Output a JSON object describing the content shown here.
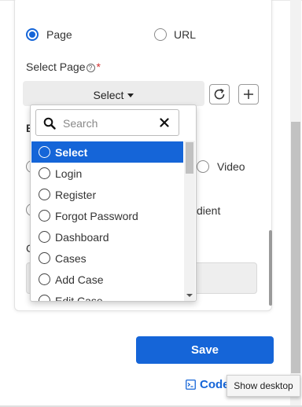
{
  "source": {
    "page_label": "Page",
    "url_label": "URL",
    "selected": "Page"
  },
  "select_page": {
    "label": "Select Page",
    "help": "?",
    "required": "*",
    "button_label": "Select"
  },
  "partials": {
    "b": "B",
    "video": "Video",
    "gradient": "dient",
    "c": "C"
  },
  "dropdown": {
    "search_placeholder": "Search",
    "options": [
      {
        "label": "Select",
        "selected": true
      },
      {
        "label": "Login",
        "selected": false
      },
      {
        "label": "Register",
        "selected": false
      },
      {
        "label": "Forgot Password",
        "selected": false
      },
      {
        "label": "Dashboard",
        "selected": false
      },
      {
        "label": "Cases",
        "selected": false
      },
      {
        "label": "Add Case",
        "selected": false
      },
      {
        "label": "Edit Case",
        "selected": false
      }
    ]
  },
  "actions": {
    "save_label": "Save",
    "code_label": "Code"
  },
  "tooltip": {
    "text": "Show desktop"
  },
  "colors": {
    "accent": "#1565d8",
    "required": "#d32f2f"
  }
}
